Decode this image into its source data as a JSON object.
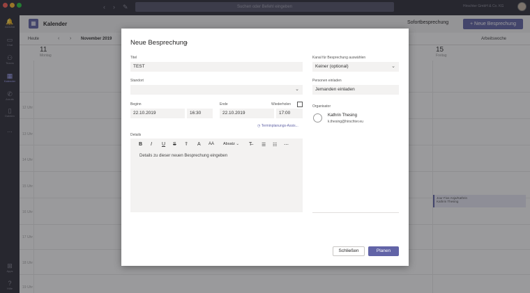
{
  "window": {
    "search_placeholder": "Suchen oder Befehl eingeben",
    "org_name": "Hirschter GmbH & Co. KG"
  },
  "rail": {
    "items": [
      {
        "label": "Aktivität",
        "icon": "bell-icon"
      },
      {
        "label": "Chat",
        "icon": "chat-icon"
      },
      {
        "label": "Teams",
        "icon": "teams-icon"
      },
      {
        "label": "Kalender",
        "icon": "calendar-icon"
      },
      {
        "label": "Anrufe",
        "icon": "phone-icon"
      },
      {
        "label": "Dateien",
        "icon": "files-icon"
      },
      {
        "label": "...",
        "icon": "more-icon"
      }
    ],
    "bottom": [
      {
        "label": "Apps",
        "icon": "apps-icon"
      },
      {
        "label": "Hilfe",
        "icon": "help-icon"
      }
    ]
  },
  "calendar": {
    "title": "Kalender",
    "meet_now": "Sofortbesprechung",
    "new_meeting": "+ Neue Besprechung",
    "today": "Heute",
    "month": "November 2019",
    "view": "Arbeitswoche",
    "days": [
      {
        "num": "11",
        "name": "Montag"
      },
      {
        "num": "15",
        "name": "Freitag"
      }
    ],
    "hours": [
      "12 Uhr",
      "13 Uhr",
      "14 Uhr",
      "15 Uhr",
      "16 Uhr",
      "17 Uhr",
      "18 Uhr",
      "19 Uhr"
    ],
    "event": {
      "title": "Jour Fixe Anja/Kathrin",
      "organizer": "Kathrin Thesing"
    }
  },
  "modal": {
    "title": "Neue Besprechung",
    "title_label": "Titel",
    "title_value": "TEST",
    "location_label": "Standort",
    "location_value": "",
    "start_label": "Beginn",
    "start_date": "22.10.2019",
    "start_time": "16:30",
    "end_label": "Ende",
    "end_date": "22.10.2019",
    "end_time": "17:00",
    "repeat_label": "Wiederholen",
    "scheduling_link": "Terminplanungs-Assis...",
    "details_label": "Details",
    "details_placeholder": "Details zu dieser neuen Besprechung eingeben",
    "toolbar": {
      "bold": "B",
      "italic": "I",
      "underline": "U",
      "strike": "S",
      "paragraph": "Absatz"
    },
    "channel_label": "Kanal für Besprechung auswählen",
    "channel_value": "Keiner (optional)",
    "people_label": "Personen einladen",
    "people_placeholder": "Jemanden einladen",
    "organizer_label": "Organisator",
    "organizer_name": "Kathrin Thesing",
    "organizer_email": "k.thesing@hirschter.eu",
    "close_label": "Schließen",
    "plan_label": "Planen"
  }
}
